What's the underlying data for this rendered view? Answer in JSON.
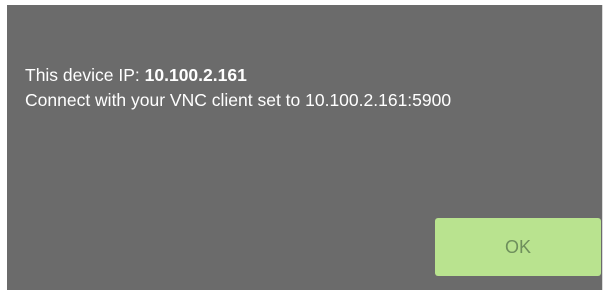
{
  "dialog": {
    "ip_prefix": "This device IP: ",
    "ip_value": "10.100.2.161",
    "connect_text": "Connect with your VNC client set to 10.100.2.161:5900",
    "ok_label": "OK"
  },
  "colors": {
    "dialog_background": "#6b6b6b",
    "text": "#ffffff",
    "ok_button_background": "#b9e38f",
    "ok_button_text": "#6e8f5c"
  }
}
